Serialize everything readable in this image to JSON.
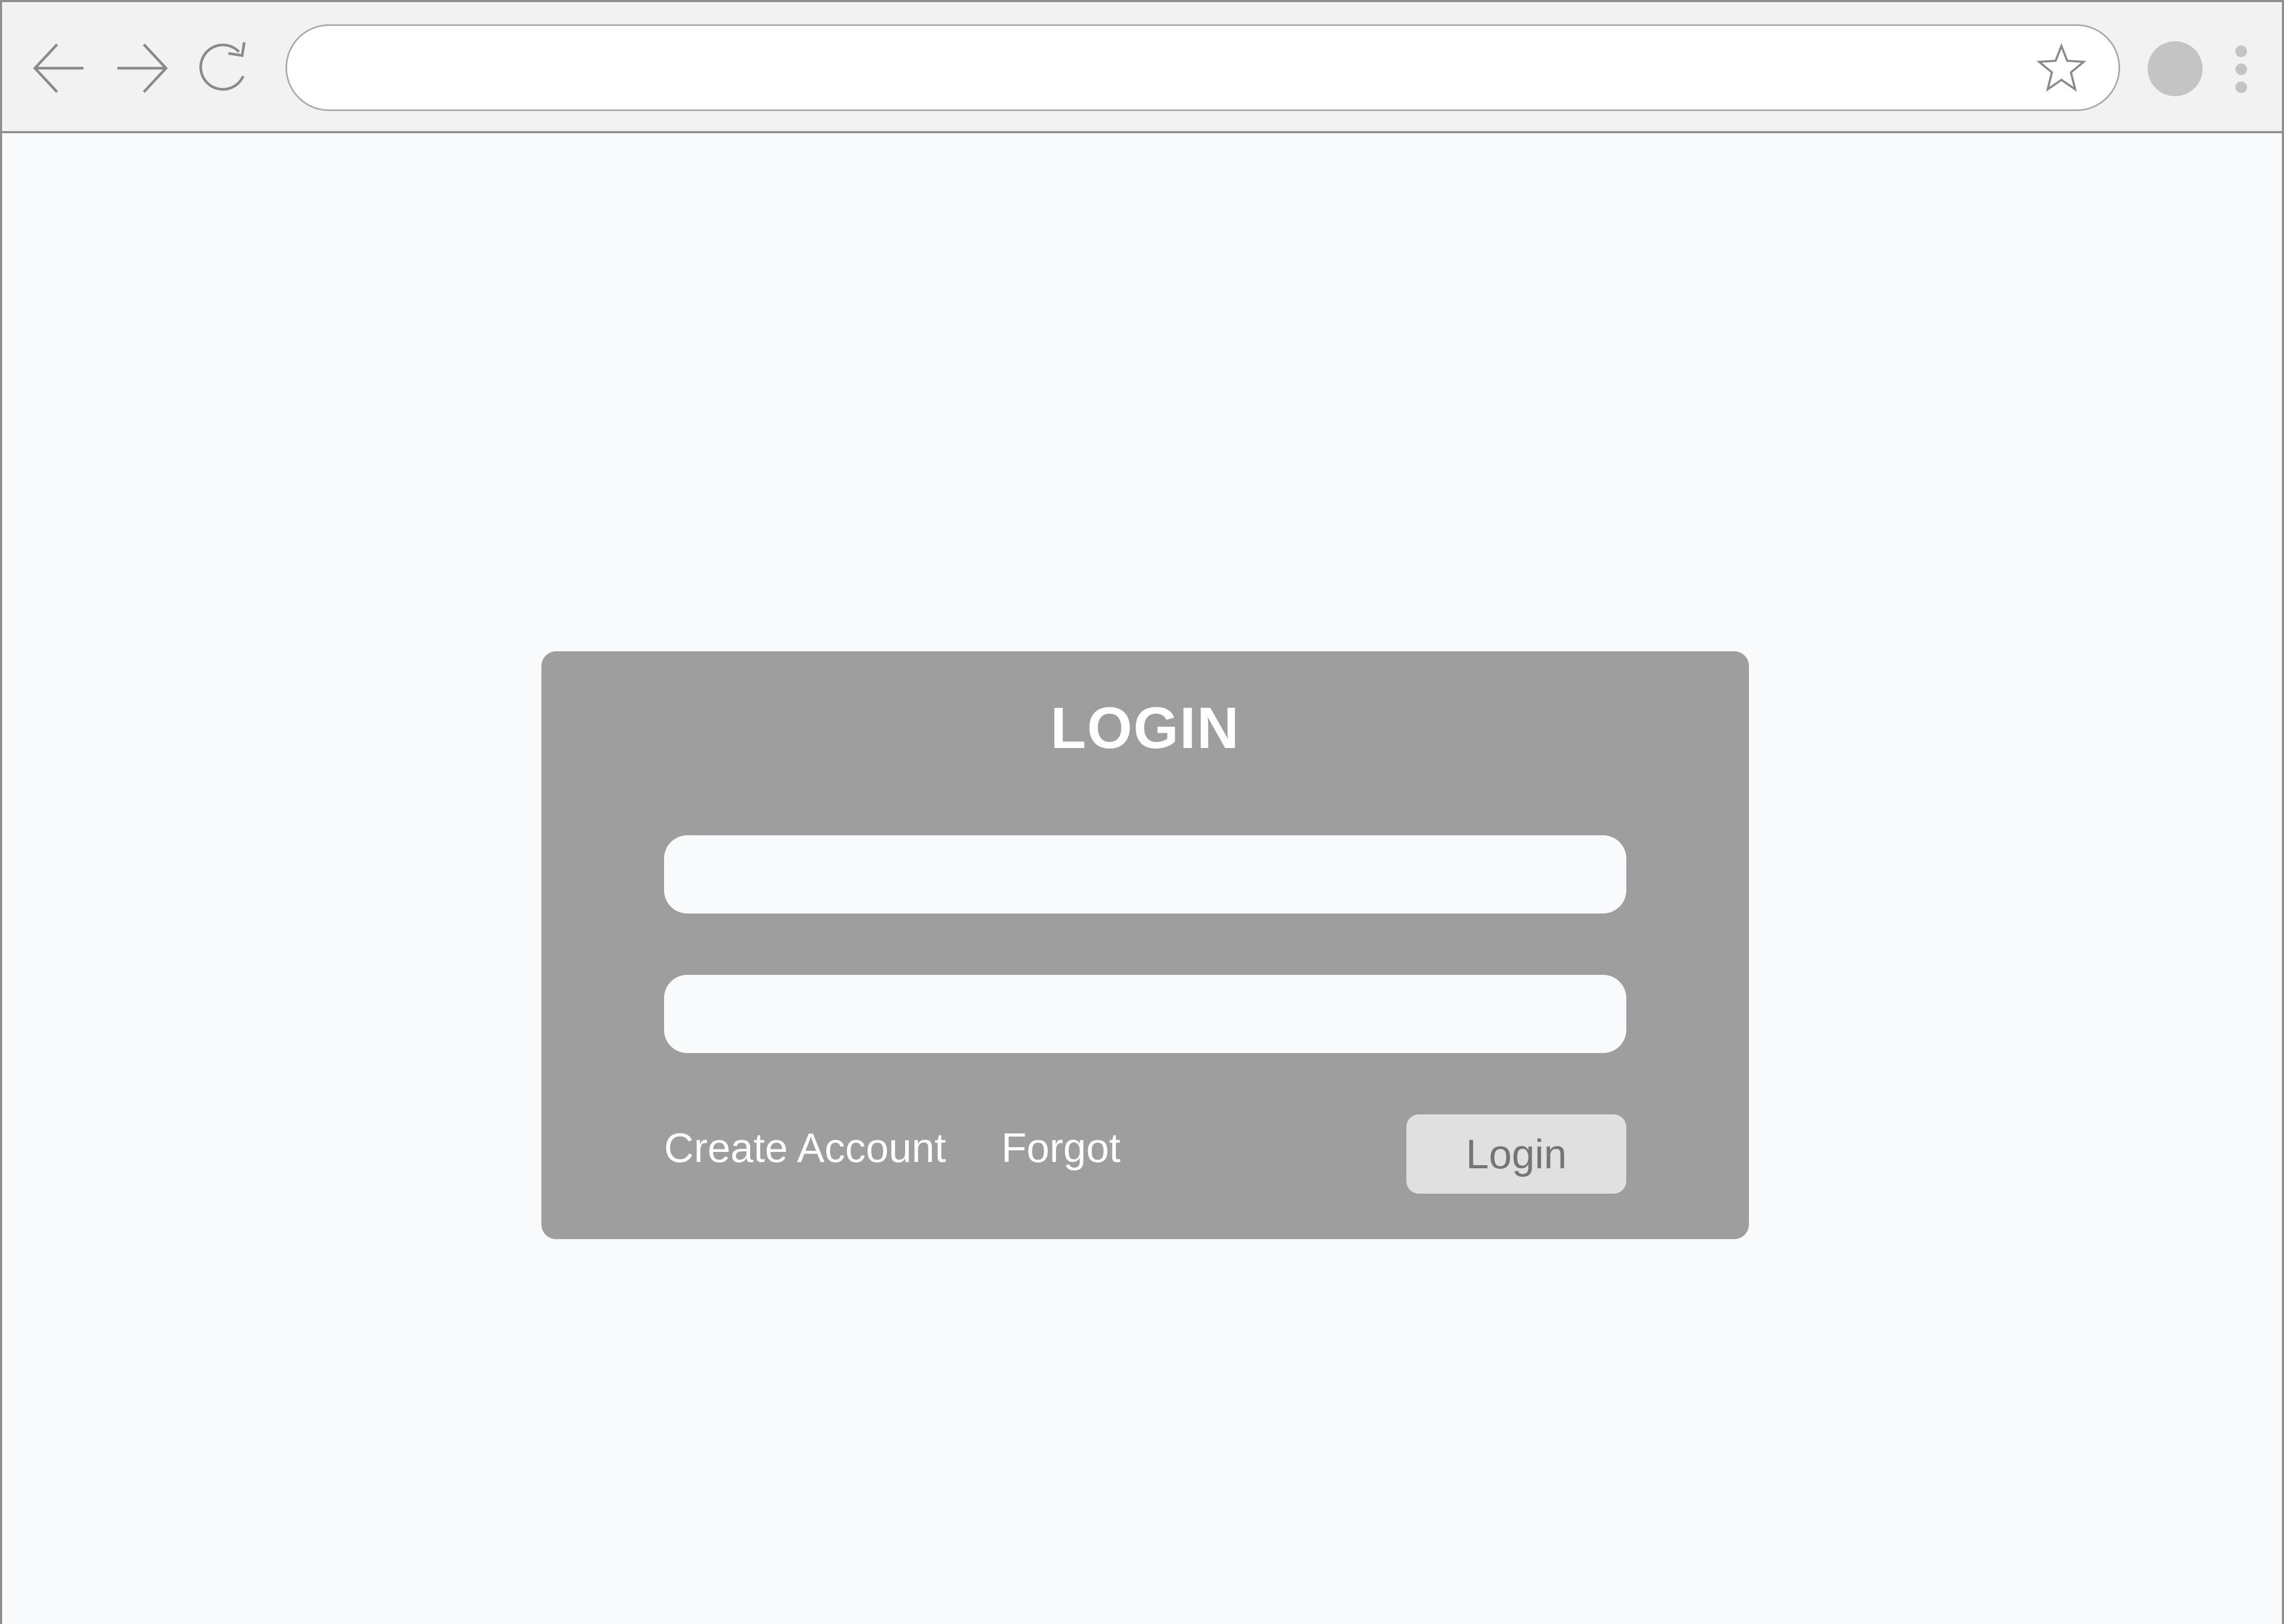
{
  "browser": {
    "address_value": "",
    "icons": {
      "back": "arrow-left-icon",
      "forward": "arrow-right-icon",
      "reload": "reload-icon",
      "bookmark": "star-icon",
      "profile": "avatar",
      "menu": "kebab-menu-icon"
    }
  },
  "login": {
    "title": "LOGIN",
    "username_value": "",
    "password_value": "",
    "create_account_label": "Create Account",
    "forgot_label": "Forgot",
    "login_button_label": "Login"
  },
  "colors": {
    "card_background": "#9e9e9e",
    "page_background": "#f9fafc",
    "button_background": "#e0e0e0",
    "button_text": "#757575",
    "toolbar_background": "#f2f2f2"
  }
}
